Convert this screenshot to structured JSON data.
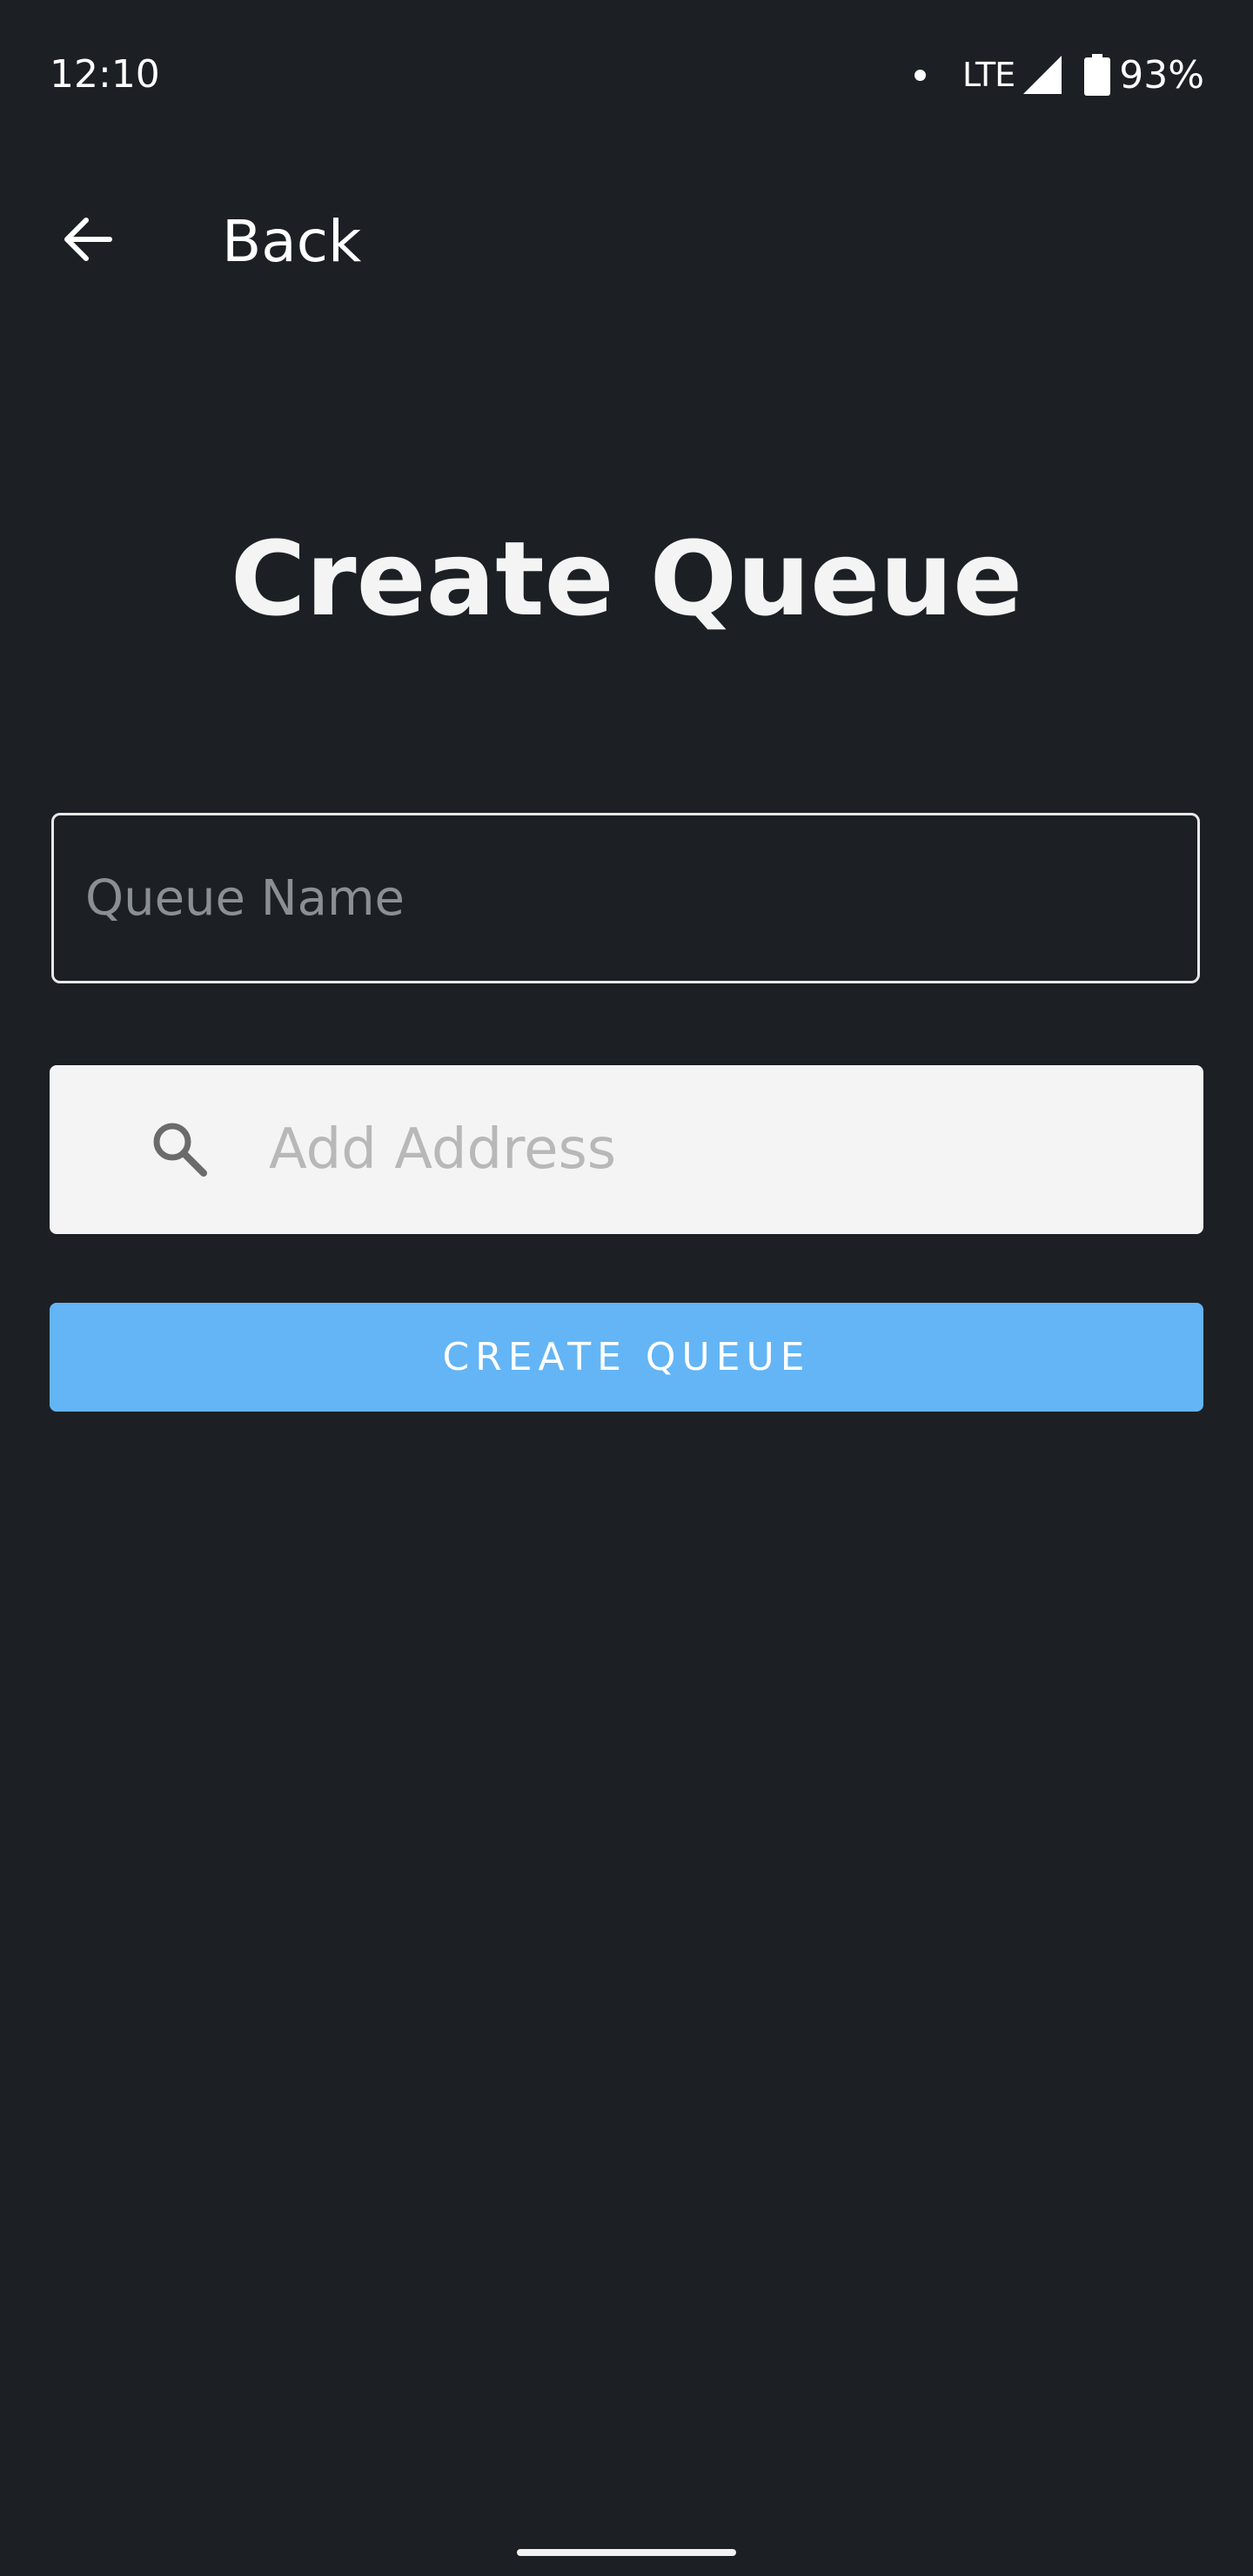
{
  "status_bar": {
    "time": "12:10",
    "network": "LTE",
    "battery": "93%"
  },
  "header": {
    "back_label": "Back"
  },
  "main": {
    "title": "Create Queue",
    "queue_name": {
      "value": "",
      "placeholder": "Queue Name"
    },
    "address": {
      "value": "",
      "placeholder": "Add Address"
    },
    "create_button_label": "CREATE QUEUE"
  },
  "colors": {
    "background": "#1c2024",
    "accent": "#63b5f6",
    "address_field": "#f4f4f4"
  },
  "icons": {
    "back": "arrow-left-icon",
    "search": "search-icon",
    "signal": "signal-icon",
    "battery": "battery-icon"
  }
}
